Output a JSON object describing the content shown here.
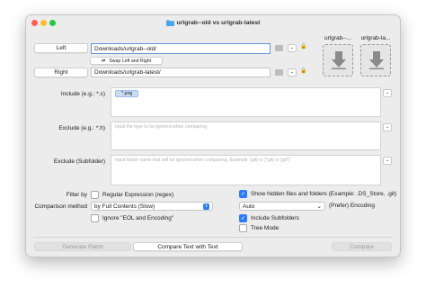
{
  "window": {
    "title": "urlgrab--old  vs  urlgrab-latest",
    "folder_icon": "folder-icon",
    "traffic_colors": [
      "#ff5f57",
      "#febc2e",
      "#28c840"
    ]
  },
  "paths": {
    "left_button": "Left",
    "left_value": "Downloads/urlgrab--old/",
    "right_button": "Right",
    "right_value": "Downloads/urlgrab-latest/",
    "swap_label": "Swap Left and Right",
    "drop_left_label": "urlgrab--...",
    "drop_right_label": "urlgrab-la..."
  },
  "filters": {
    "include_label": "Include (e.g.: *.c)",
    "include_token": "*.png",
    "exclude_label": "Exclude (e.g.: *.h)",
    "exclude_placeholder": "Input file type to be ignored when comparing",
    "exclude_folder_label": "Exclude (Subfolder)",
    "exclude_folder_placeholder": "Input folder name that will be ignored when comparing, Example: [git] or [*git] or [git*]"
  },
  "options": {
    "filter_by_label": "Filter by",
    "regex_label": "Regular Expression (regex)",
    "regex_checked": false,
    "comparison_label": "Comparison method",
    "comparison_value": "by Full Contents (Slow)",
    "ignore_eol_label": "Ignore \"EOL and Encoding\"",
    "ignore_eol_checked": false,
    "show_hidden_label": "Show hidden files and folders (Example: .DS_Store, .git)",
    "show_hidden_checked": true,
    "encoding_value": "Auto",
    "encoding_label": "(Prefer) Encoding",
    "include_subfolders_label": "Include Subfolders",
    "include_subfolders_checked": true,
    "tree_mode_label": "Tree Mode",
    "tree_mode_checked": false
  },
  "footer": {
    "generate_patch": "Generate Patch",
    "compare_text": "Compare Text with Text",
    "compare": "Compare"
  },
  "glyphs": {
    "check": "✓",
    "chevron": "⌄",
    "lock": "🔓",
    "stepper": "⇕",
    "swap": "⇄"
  },
  "colors": {
    "accent": "#2f7bf6",
    "focus": "#5f95d8",
    "token_bg": "#c8dcf6"
  }
}
